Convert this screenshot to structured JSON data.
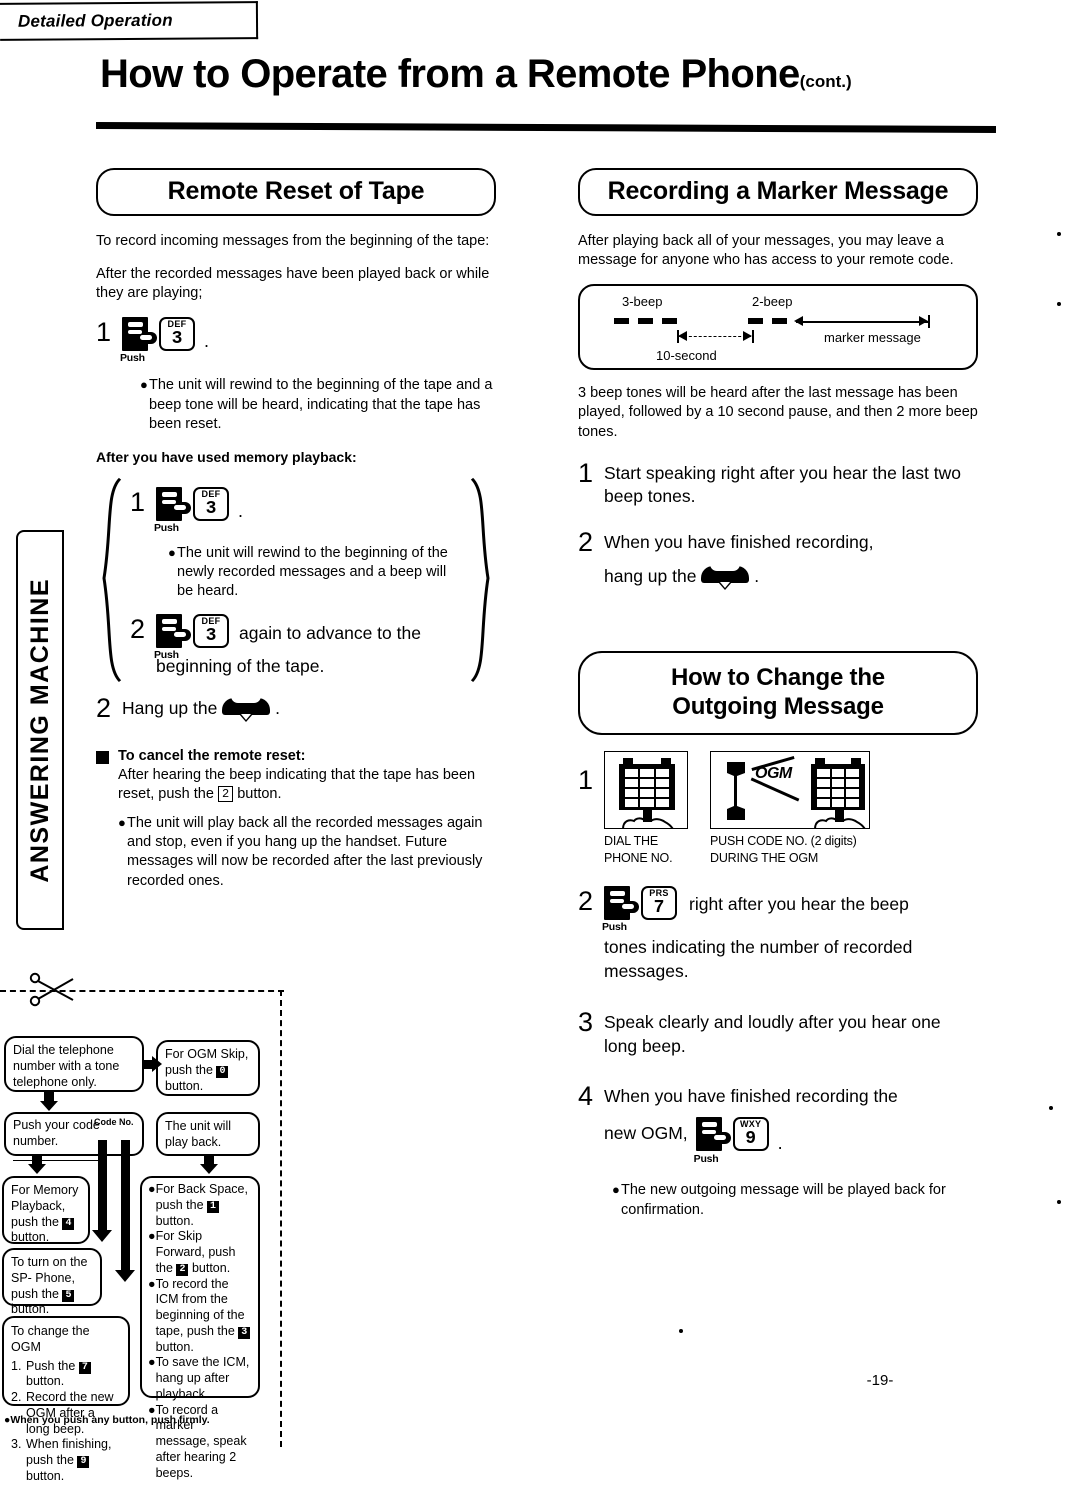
{
  "header": {
    "tab_label": "Detailed Operation",
    "title": "How to Operate from a Remote Phone",
    "title_suffix": "(cont.)"
  },
  "side_tab": {
    "label": "ANSWERING MACHINE"
  },
  "page_number": "-19-",
  "left_column": {
    "section_title": "Remote Reset of Tape",
    "intro_1": "To record incoming messages from the beginning of the tape:",
    "intro_2": "After the recorded messages have been played back or while they are playing;",
    "step1": {
      "num": "1",
      "push_label": "Push",
      "key_letters": "DEF",
      "key_digit": "3",
      "period": "."
    },
    "step1_bullet": "The unit will rewind to the beginning of the tape and a beep tone will be heard, indicating that the tape has been reset.",
    "memory_heading": "After you have used memory playback:",
    "brace": {
      "step1": {
        "num": "1",
        "push_label": "Push",
        "key_letters": "DEF",
        "key_digit": "3",
        "period": "."
      },
      "step1_bullet": "The unit will rewind to the beginning of the newly recorded messages and a beep will be heard.",
      "step2": {
        "num": "2",
        "push_label": "Push",
        "key_letters": "DEF",
        "key_digit": "3",
        "text": "again to advance to the",
        "text2": "beginning of the tape."
      }
    },
    "step2": {
      "num": "2",
      "text_before": "Hang up the",
      "icon": "handset-icon",
      "text_after": "."
    },
    "cancel": {
      "heading": "To cancel the remote reset:",
      "body_before": "After hearing the beep indicating that the tape has been reset, push the",
      "body_digit": "2",
      "body_after": "button.",
      "bullet": "The unit will play back all the recorded messages again and stop, even if you hang up the handset. Future messages will now be recorded after the last previously recorded ones."
    }
  },
  "cut_card": {
    "scissors_icon": "scissors-icon",
    "box_dial": "Dial the telephone number with a tone telephone only.",
    "box_ogm_skip_before": "For OGM Skip, push the",
    "box_ogm_skip_digit": "0",
    "box_ogm_skip_after": "button.",
    "box_code_before": "Push your code number.",
    "box_code_label": "Code No.",
    "box_playback": "The unit will play back.",
    "box_memory_before": "For Memory Playback, push the",
    "box_memory_digit": "4",
    "box_memory_after": "button.",
    "box_spphone_before": "To turn on the SP- Phone, push the",
    "box_spphone_digit": "5",
    "box_spphone_after": "button.",
    "box_ogm_title": "To change the OGM",
    "box_ogm_items": [
      {
        "n": "1.",
        "before": "Push the",
        "digit": "7",
        "after": "button."
      },
      {
        "n": "2.",
        "before": "Record the new OGM after a long beep.",
        "digit": "",
        "after": ""
      },
      {
        "n": "3.",
        "before": "When finishing, push the",
        "digit": "9",
        "after": "button."
      }
    ],
    "box_right_bullets": [
      {
        "before": "For Back Space, push the",
        "digit": "1",
        "after": "button."
      },
      {
        "before": "For Skip Forward, push the",
        "digit": "2",
        "after": "button."
      },
      {
        "before": "To record the ICM from the beginning of the tape, push the",
        "digit": "3",
        "after": "button."
      },
      {
        "before": "To save the ICM, hang up after playback.",
        "digit": "",
        "after": ""
      },
      {
        "before": "To record a marker message, speak after hearing 2 beeps.",
        "digit": "",
        "after": ""
      }
    ],
    "footnote": "When you push any button, push firmly."
  },
  "right_column": {
    "section_title": "Recording a Marker Message",
    "intro": "After playing back all of your messages, you may leave a message for anyone who has access to your remote code.",
    "diagram": {
      "label_3beep": "3-beep",
      "label_2beep": "2-beep",
      "label_10second": "10-second",
      "label_marker": "marker message"
    },
    "after_diagram": "3 beep tones will be heard after the last message has been played, followed by a 10 second pause, and then 2 more beep tones.",
    "step1": {
      "num": "1",
      "text": "Start speaking right after you hear the last two beep tones."
    },
    "step2": {
      "num": "2",
      "text": "When you have finished recording,",
      "text2_before": "hang up the",
      "icon": "handset-icon",
      "text2_after": "."
    },
    "ogm_section_title_line1": "How to Change the",
    "ogm_section_title_line2": "Outgoing Message",
    "ogm_step1": {
      "num": "1",
      "illus1_icon": "telephone-keypad-icon",
      "illus1_caption_line1": "DIAL THE",
      "illus1_caption_line2": "PHONE NO.",
      "illus2_icon": "handset-ogm-keypad-icon",
      "illus2_ogm_label": "OGM",
      "illus2_caption_line1": "PUSH CODE NO. (2 digits)",
      "illus2_caption_line2": "DURING THE OGM"
    },
    "ogm_step2": {
      "num": "2",
      "push_label": "Push",
      "key_letters": "PRS",
      "key_digit": "7",
      "text": "right after you hear the beep",
      "text2": "tones indicating the number of recorded messages."
    },
    "ogm_step3": {
      "num": "3",
      "text": "Speak clearly and loudly after you hear one long beep."
    },
    "ogm_step4": {
      "num": "4",
      "text_line1": "When you have finished recording the",
      "text_line2": "new OGM,",
      "push_label": "Push",
      "key_letters": "WXY",
      "key_digit": "9",
      "period": ".",
      "bullet": "The new outgoing message will be played back for confirmation."
    }
  }
}
